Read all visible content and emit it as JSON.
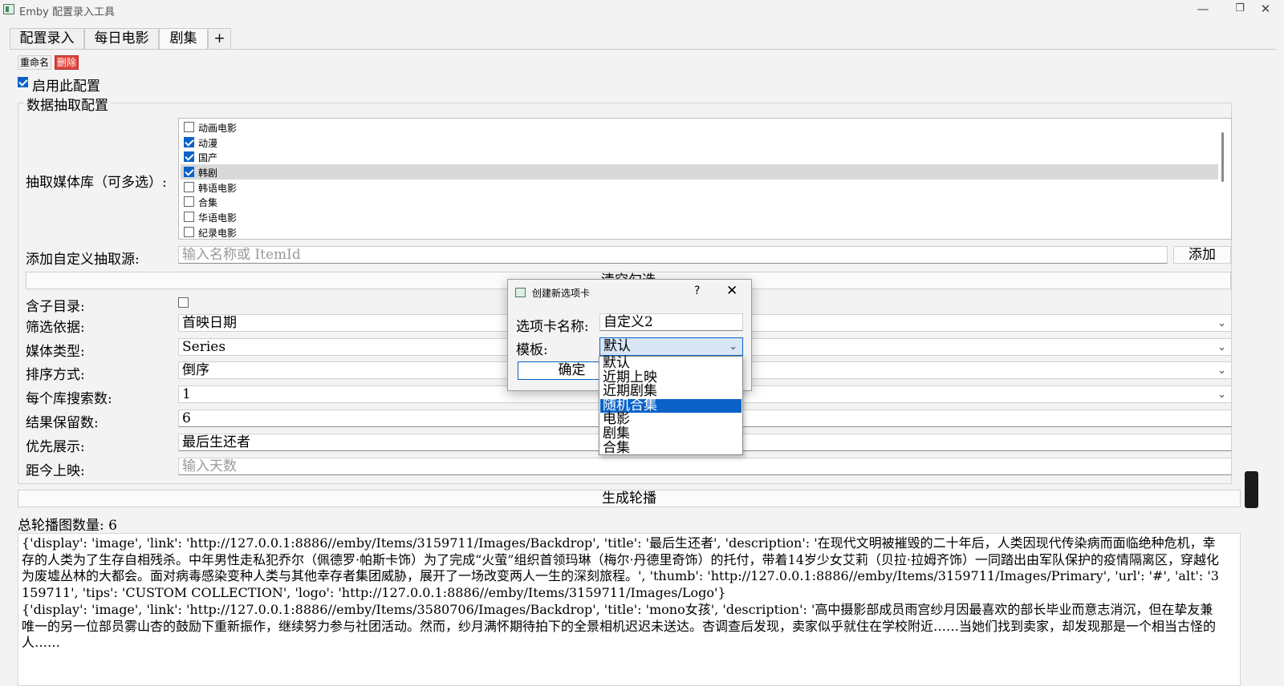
{
  "window": {
    "title": "Emby 配置录入工具",
    "controls": {
      "minimize": "—",
      "maximize": "❐",
      "close": "✕"
    }
  },
  "tabs": [
    "配置录入",
    "每日电影",
    "剧集",
    "+"
  ],
  "active_tab": "剧集",
  "toolbar": {
    "rename_label": "重命名",
    "delete_label": "删除"
  },
  "enable": {
    "label": "启用此配置",
    "checked": true
  },
  "group": {
    "title": "数据抽取配置",
    "libraries_label": "抽取媒体库（可多选）:",
    "libraries": [
      {
        "name": "动画电影",
        "checked": false
      },
      {
        "name": "动漫",
        "checked": true
      },
      {
        "name": "国产",
        "checked": true
      },
      {
        "name": "韩剧",
        "checked": true,
        "selected": true
      },
      {
        "name": "韩语电影",
        "checked": false
      },
      {
        "name": "合集",
        "checked": false
      },
      {
        "name": "华语电影",
        "checked": false
      },
      {
        "name": "纪录电影",
        "checked": false
      }
    ],
    "custom_source_label": "添加自定义抽取源:",
    "custom_source_placeholder": "输入名称或 ItemId",
    "add_button": "添加",
    "clear_button": "清空勾选",
    "subdir_label": "含子目录:",
    "subdir_checked": false,
    "filter_label": "筛选依据:",
    "filter_value": "首映日期",
    "media_type_label": "媒体类型:",
    "media_type_value": "Series",
    "sort_label": "排序方式:",
    "sort_value": "倒序",
    "per_lib_label": "每个库搜索数:",
    "per_lib_value": "1",
    "keep_label": "结果保留数:",
    "keep_value": "6",
    "priority_label": "优先展示:",
    "priority_value": "最后生还者",
    "days_label": "距今上映:",
    "days_placeholder": "输入天数"
  },
  "generate_button": "生成轮播",
  "total_label": "总轮播图数量: 6",
  "result_text": "{'display': 'image', 'link': 'http://127.0.0.1:8886//emby/Items/3159711/Images/Backdrop', 'title': '最后生还者', 'description': '在现代文明被摧毁的二十年后，人类因现代传染病而面临绝种危机，幸存的人类为了生存自相残杀。中年男性走私犯乔尔（佩德罗·帕斯卡饰）为了完成“火萤”组织首领玛琳（梅尔·丹德里奇饰）的托付，带着14岁少女艾莉（贝拉·拉姆齐饰）一同踏出由军队保护的疫情隔离区，穿越化为废墟丛林的大都会。面对病毒感染变种人类与其他幸存者集团威胁，展开了一场改变两人一生的深刻旅程。', 'thumb': 'http://127.0.0.1:8886//emby/Items/3159711/Images/Primary', 'url': '#', 'alt': '3159711', 'tips': 'CUSTOM COLLECTION', 'logo': 'http://127.0.0.1:8886//emby/Items/3159711/Images/Logo'}\n{'display': 'image', 'link': 'http://127.0.0.1:8886//emby/Items/3580706/Images/Backdrop', 'title': 'mono女孩', 'description': '高中摄影部成员雨宫纱月因最喜欢的部长毕业而意志消沉，但在挚友兼唯一的另一位部员雾山杏的鼓励下重新振作，继续努力参与社团活动。然而，纱月满怀期待拍下的全景相机迟迟未送达。杏调查后发现，卖家似乎就住在学校附近……当她们找到卖家，却发现那是一个相当古怪的人……",
  "dialog": {
    "title": "创建新选项卡",
    "help": "?",
    "close": "✕",
    "name_label": "选项卡名称:",
    "name_value": "自定义2",
    "template_label": "模板:",
    "template_value": "默认",
    "ok_button": "确定",
    "template_options": [
      "默认",
      "近期上映",
      "近期剧集",
      "随机合集",
      "电影",
      "剧集",
      "合集"
    ],
    "highlighted_option": "随机合集"
  },
  "colors": {
    "accent": "#0a62c8",
    "delete": "#e2453c"
  }
}
